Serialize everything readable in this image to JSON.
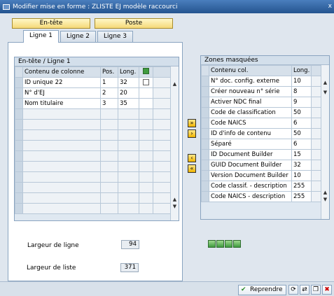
{
  "window": {
    "title": "Modifier mise en forme : ZLISTE EJ modèle raccourci",
    "close_glyph": "x"
  },
  "top_buttons": {
    "header": "En-tête",
    "item": "Poste"
  },
  "tabs": [
    "Ligne 1",
    "Ligne 2",
    "Ligne 3"
  ],
  "left_box": {
    "title": "En-tête / Ligne 1",
    "columns": {
      "content": "Contenu de colonne",
      "pos": "Pos.",
      "len": "Long."
    },
    "rows": [
      {
        "content": "ID unique 22",
        "pos": "1",
        "len": "32"
      },
      {
        "content": "N° d'EJ",
        "pos": "2",
        "len": "20"
      },
      {
        "content": "Nom titulaire",
        "pos": "3",
        "len": "35"
      }
    ],
    "empty_rows": 10
  },
  "right_box": {
    "title": "Zones masquées",
    "columns": {
      "content": "Contenu col.",
      "len": "Long."
    },
    "rows": [
      {
        "content": "N° doc. config. externe",
        "len": "10"
      },
      {
        "content": "Créer nouveau n° série",
        "len": "8"
      },
      {
        "content": "Activer NDC final",
        "len": "9"
      },
      {
        "content": "Code de classification",
        "len": "50"
      },
      {
        "content": "Code NAICS",
        "len": "6"
      },
      {
        "content": "ID d'info de contenu",
        "len": "50"
      },
      {
        "content": "Séparé",
        "len": "6"
      },
      {
        "content": "ID Document Builder",
        "len": "15"
      },
      {
        "content": "GUID Document Builder",
        "len": "32"
      },
      {
        "content": "Version Document Builder",
        "len": "10"
      },
      {
        "content": "Code classif. - description",
        "len": "255"
      },
      {
        "content": "Code NAICS - description",
        "len": "255"
      }
    ]
  },
  "line_width": {
    "label": "Largeur de ligne",
    "value": "94"
  },
  "list_width": {
    "label": "Largeur de liste",
    "value": "371"
  },
  "footer": {
    "ok_label": "Reprendre"
  },
  "colors": {
    "title_bar": "#2a5f9e",
    "button_yellow": "#f5d978",
    "background": "#dfe6ee"
  }
}
